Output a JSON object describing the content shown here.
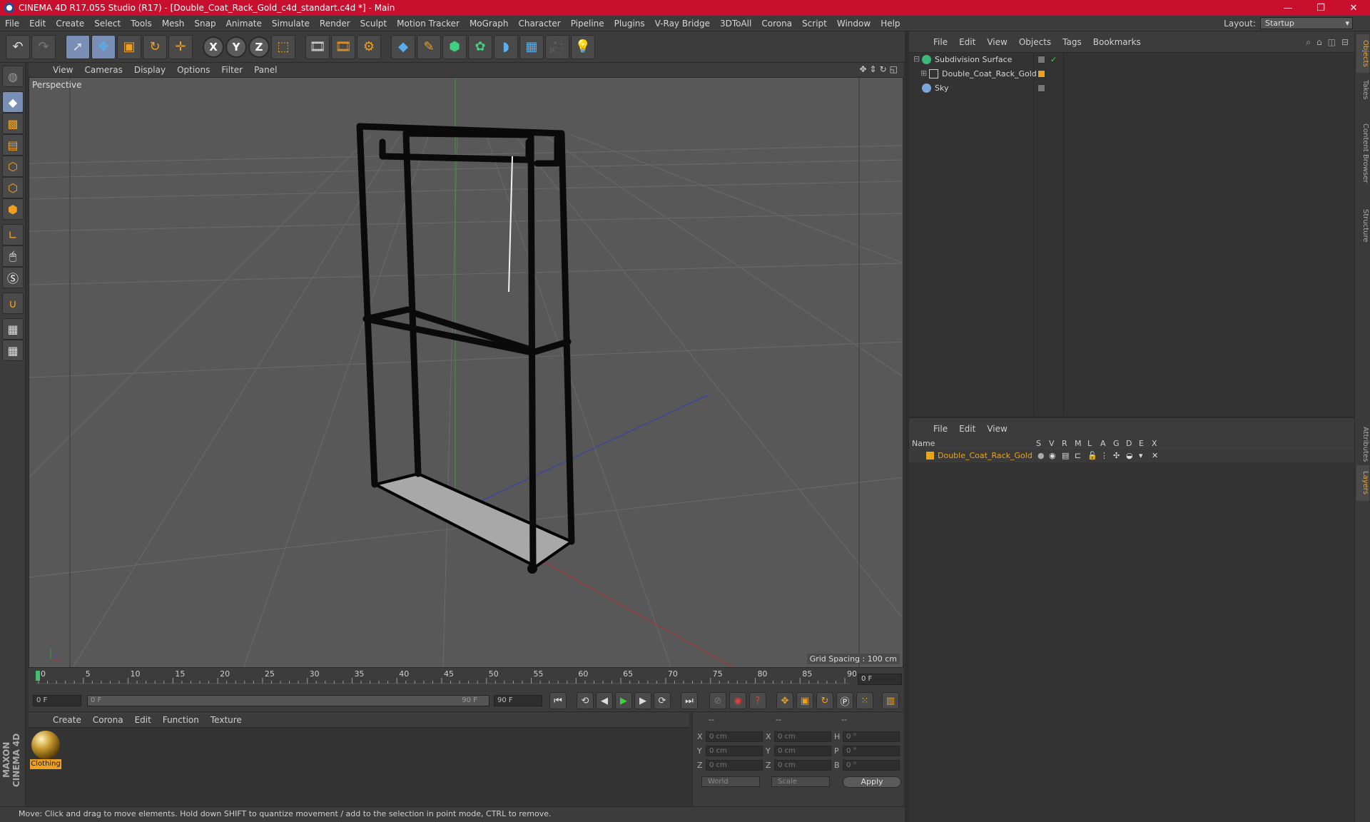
{
  "window": {
    "title": "CINEMA 4D R17.055 Studio (R17) - [Double_Coat_Rack_Gold_c4d_standart.c4d *] - Main",
    "minimize": "—",
    "maximize": "❐",
    "close": "✕"
  },
  "menu": [
    "File",
    "Edit",
    "Create",
    "Select",
    "Tools",
    "Mesh",
    "Snap",
    "Animate",
    "Simulate",
    "Render",
    "Sculpt",
    "Motion Tracker",
    "MoGraph",
    "Character",
    "Pipeline",
    "Plugins",
    "V-Ray Bridge",
    "3DToAll",
    "Corona",
    "Script",
    "Window",
    "Help"
  ],
  "layout": {
    "label": "Layout:",
    "value": "Startup"
  },
  "toolbar": {
    "axis_x": "X",
    "axis_y": "Y",
    "axis_z": "Z"
  },
  "viewport": {
    "menu": [
      "View",
      "Cameras",
      "Display",
      "Options",
      "Filter",
      "Panel"
    ],
    "label": "Perspective",
    "grid_spacing": "Grid Spacing : 100 cm"
  },
  "timeline": {
    "ticks": [
      "0",
      "5",
      "10",
      "15",
      "20",
      "25",
      "30",
      "35",
      "40",
      "45",
      "50",
      "55",
      "60",
      "65",
      "70",
      "75",
      "80",
      "85",
      "90"
    ],
    "current_frame": "0 F",
    "start_frame": "0 F",
    "range_start": "0 F",
    "range_end": "90 F",
    "end_frame": "90 F"
  },
  "material_manager": {
    "menu": [
      "Create",
      "Corona",
      "Edit",
      "Function",
      "Texture"
    ],
    "material_name": "Clothing"
  },
  "coordinates": {
    "headers": [
      "--",
      "--",
      "--"
    ],
    "rows": [
      {
        "a": "X",
        "a_val": "0 cm",
        "b": "X",
        "b_val": "0 cm",
        "c": "H",
        "c_val": "0 °"
      },
      {
        "a": "Y",
        "a_val": "0 cm",
        "b": "Y",
        "b_val": "0 cm",
        "c": "P",
        "c_val": "0 °"
      },
      {
        "a": "Z",
        "a_val": "0 cm",
        "b": "Z",
        "b_val": "0 cm",
        "c": "B",
        "c_val": "0 °"
      }
    ],
    "coord_mode": "World",
    "size_mode": "Scale",
    "apply": "Apply"
  },
  "status": "Move: Click and drag to move elements. Hold down SHIFT to quantize movement / add to the selection in point mode, CTRL to remove.",
  "object_manager": {
    "menu": [
      "File",
      "Edit",
      "View",
      "Objects",
      "Tags",
      "Bookmarks"
    ],
    "objects": [
      {
        "name": "Subdivision Surface",
        "tag_color": "#777777"
      },
      {
        "name": "Double_Coat_Rack_Gold",
        "tag_color": "#e8a41a"
      },
      {
        "name": "Sky",
        "tag_color": "#777777"
      }
    ]
  },
  "layer_manager": {
    "menu": [
      "File",
      "Edit",
      "View"
    ],
    "columns": [
      "Name",
      "S",
      "V",
      "R",
      "M",
      "L",
      "A",
      "G",
      "D",
      "E",
      "X"
    ],
    "layers": [
      {
        "name": "Double_Coat_Rack_Gold",
        "color": "#e8a41a"
      }
    ]
  },
  "side_tabs": [
    "Objects",
    "Takes",
    "Content Browser",
    "Structure"
  ],
  "side_tabs_lower": [
    "Attributes",
    "Layers"
  ],
  "branding": "MAXON CINEMA 4D"
}
